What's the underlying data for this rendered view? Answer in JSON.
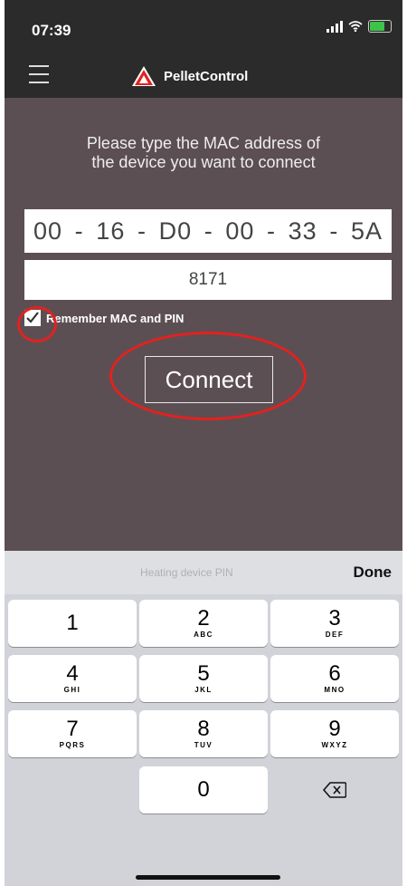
{
  "status_bar": {
    "time": "07:39"
  },
  "nav": {
    "title": "PelletControl"
  },
  "main": {
    "instructions": "Please type the MAC address of the device you want to connect",
    "mac_parts": [
      "00",
      "-",
      "16",
      "-",
      "D0",
      "-",
      "00",
      "-",
      "33",
      "-",
      "5A"
    ],
    "pin_value": "8171",
    "remember_label": "Remember MAC and PIN",
    "remember_checked": true,
    "connect_label": "Connect",
    "highlight_color": "#e3211f"
  },
  "keyboard": {
    "placeholder": "Heating device PIN",
    "done_label": "Done",
    "keys": [
      {
        "num": "1",
        "letters": ""
      },
      {
        "num": "2",
        "letters": "ABC"
      },
      {
        "num": "3",
        "letters": "DEF"
      },
      {
        "num": "4",
        "letters": "GHI"
      },
      {
        "num": "5",
        "letters": "JKL"
      },
      {
        "num": "6",
        "letters": "MNO"
      },
      {
        "num": "7",
        "letters": "PQRS"
      },
      {
        "num": "8",
        "letters": "TUV"
      },
      {
        "num": "9",
        "letters": "WXYZ"
      },
      {
        "num": "0",
        "letters": ""
      }
    ],
    "backspace_icon": "backspace-icon"
  },
  "colors": {
    "header_bg": "#2b2b2b",
    "content_bg": "#5c4f53",
    "logo_red": "#e3211f"
  }
}
